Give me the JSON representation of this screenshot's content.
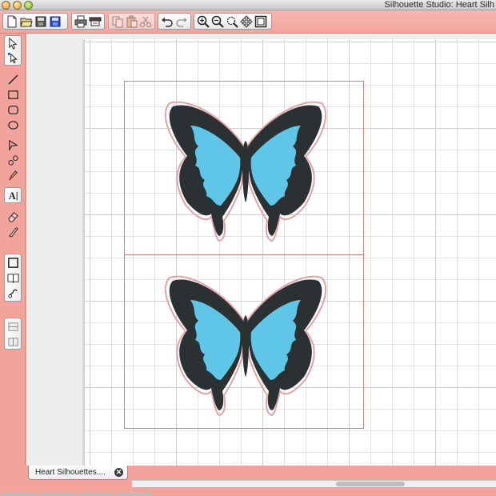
{
  "window": {
    "title": "Silhouette Studio: Heart Silh"
  },
  "toolbar": {
    "groups": [
      {
        "name": "file",
        "buttons": [
          "new-document-icon",
          "open-folder-icon",
          "save-icon",
          "save-library-icon"
        ]
      },
      {
        "name": "print",
        "buttons": [
          "print-icon",
          "send-to-cutter-icon"
        ]
      },
      {
        "name": "clipboard",
        "buttons": [
          "copy-icon",
          "paste-icon",
          "cut-icon"
        ]
      },
      {
        "name": "history",
        "buttons": [
          "undo-icon",
          "redo-icon"
        ]
      },
      {
        "name": "zoom",
        "buttons": [
          "zoom-in-icon",
          "zoom-out-icon",
          "zoom-selection-icon",
          "pan-icon",
          "fit-page-icon"
        ]
      }
    ]
  },
  "tools": {
    "icons": [
      "select-icon",
      "point-edit-icon",
      "line-icon",
      "rectangle-icon",
      "rounded-rectangle-icon",
      "ellipse-icon",
      "polygon-icon",
      "curve-icon",
      "freehand-icon",
      "text-icon",
      "eraser-icon",
      "knife-icon",
      "page-setup-icon",
      "library-icon",
      "trace-icon",
      "panel-top-icon",
      "panel-bottom-icon"
    ]
  },
  "canvas": {
    "grid": true,
    "colors": {
      "wing": "#5fc6e8",
      "wing_dark": "#2b3033",
      "cut_line": "#e37d7d",
      "chrome": "#f4a9a3"
    },
    "objects": [
      "butterfly-top",
      "butterfly-bottom"
    ]
  },
  "document": {
    "tab_label": "Heart Silhouettes....",
    "close_symbol": "✕"
  }
}
